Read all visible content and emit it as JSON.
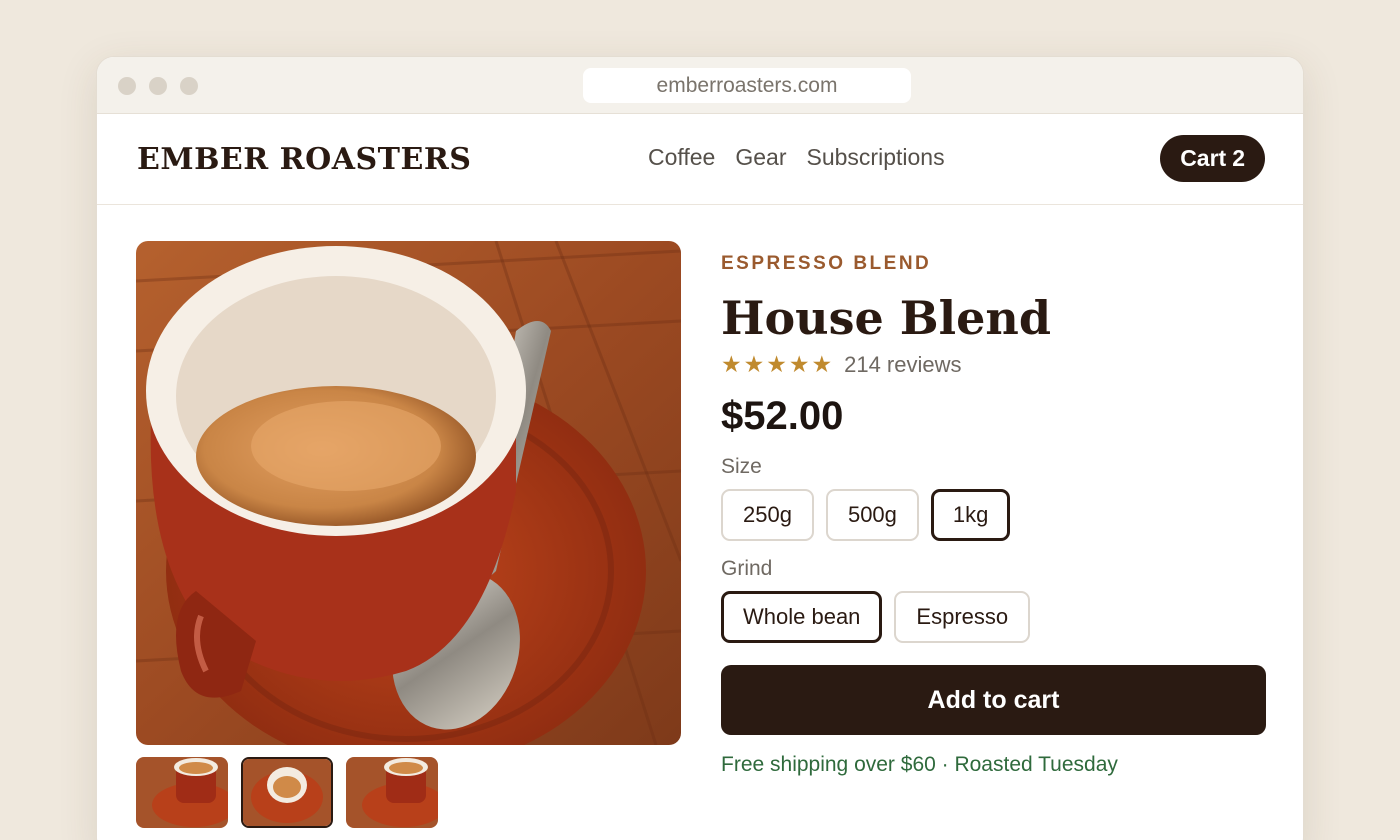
{
  "browser": {
    "url": "emberroasters.com"
  },
  "header": {
    "logo": "EMBER ROASTERS",
    "nav": [
      "Coffee",
      "Gear",
      "Subscriptions"
    ],
    "cart_label": "Cart",
    "cart_count": "2"
  },
  "gallery": {
    "main_image": "espresso-cup-on-red-saucer",
    "thumbnails": [
      "espresso-side-view",
      "espresso-top-view",
      "espresso-side-view"
    ]
  },
  "product": {
    "category": "ESPRESSO BLEND",
    "name": "House Blend",
    "rating_stars": "★★★★★",
    "rating": 5,
    "reviews": "214 reviews",
    "price": "$52.00"
  },
  "size": {
    "label": "Size",
    "options": [
      "250g",
      "500g",
      "1kg"
    ],
    "selected": "1kg"
  },
  "grind": {
    "label": "Grind",
    "options": [
      "Whole bean",
      "Espresso"
    ],
    "selected": "Whole bean"
  },
  "cta": {
    "add_to_cart": "Add to cart"
  },
  "shipping_note": "Free shipping over $60 · Roasted Tuesday",
  "colors": {
    "brand_dark": "#2a1a12",
    "accent": "#9a5a2e",
    "star": "#c08a2e",
    "success": "#2f6a3c"
  }
}
